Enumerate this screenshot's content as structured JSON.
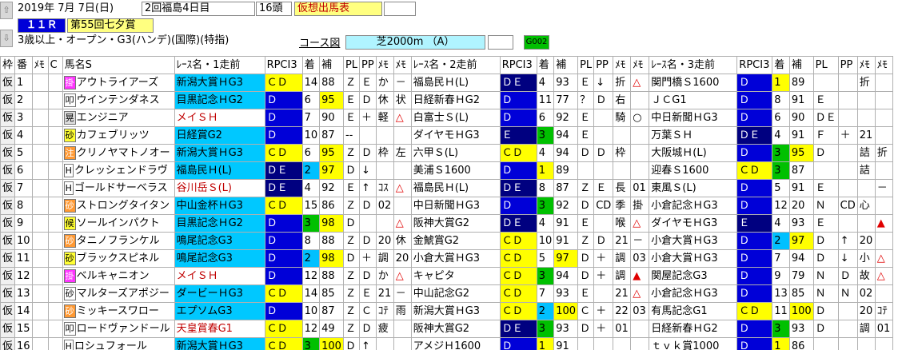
{
  "header": {
    "up_arrow": "⇧",
    "down_arrow": "⇩",
    "date": "2019年 7月 7日(日)",
    "meet": "2回福島4日目",
    "runners": "16頭",
    "mode_badge": "仮想出馬表",
    "race_no": "１１Ｒ",
    "race_name": "第55回七夕賞",
    "conditions": "3歳以上・オープン・G3(ハンデ)(国際)(特指)",
    "course_label": "コース図",
    "course": "芝2000m （A）",
    "code": "G002"
  },
  "columns": {
    "waku": "枠",
    "ban": "番",
    "memo": "ﾒﾓ",
    "c": "C",
    "name": "馬名S",
    "r1": "ﾚｰｽ名・1走前",
    "r2": "ﾚｰｽ名・2走前",
    "r3": "ﾚｰｽ名・3走前",
    "rpci": "RPCI3",
    "chaku": "着",
    "ho": "補",
    "pl": "PL",
    "pp": "PP",
    "m1": "ﾒﾓ",
    "m2": "ﾒﾓ"
  },
  "colors": {
    "race_blue": "#0000d8",
    "yellow": "#ffff80",
    "cyan": "#00c8ff",
    "green": "#00c000",
    "header_pink": "#ffcce0"
  },
  "horses": [
    {
      "waku": "仮",
      "ban": "1",
      "mark": "掛",
      "mk": "m",
      "name": "アウトライアーズ",
      "p1": [
        "新潟大賞ＨG3",
        "ＣＤ",
        "14",
        "88",
        "Ｚ",
        "Ｅ",
        "か",
        "－"
      ],
      "p2": [
        "福島民Ｈ(L)",
        "ＤＥ",
        "4",
        "93",
        "Ｅ",
        "↓",
        "折",
        "△"
      ],
      "p3": [
        "関門橋Ｓ1600",
        "Ｄ",
        "1",
        "89",
        "",
        "",
        "折",
        ""
      ]
    },
    {
      "waku": "仮",
      "ban": "2",
      "mark": "叩",
      "mk": "w",
      "name": "ウインテンダネス",
      "p1": [
        "目黒記念ＨG2",
        "Ｄ",
        "6",
        "95",
        "Ｅ",
        "Ｄ",
        "休",
        "状"
      ],
      "p2": [
        "日経新春ＨG2",
        "Ｄ",
        "11",
        "77",
        "？",
        "Ｄ",
        "右",
        ""
      ],
      "p3": [
        "ＪＣG1",
        "Ｄ",
        "8",
        "91",
        "Ｅ",
        "",
        "",
        ""
      ]
    },
    {
      "waku": "仮",
      "ban": "3",
      "mark": "晃",
      "mk": "h",
      "name": "エンジニア",
      "p1": [
        "メイＳＨ",
        "Ｄ",
        "7",
        "90",
        "Ｅ",
        "＋",
        "軽",
        "△"
      ],
      "p2": [
        "白富士Ｓ(L)",
        "Ｄ",
        "6",
        "92",
        "Ｅ",
        "",
        "騎",
        "○"
      ],
      "p3": [
        "中日新聞ＨG3",
        "Ｄ",
        "6",
        "90",
        "ＤＥ",
        "",
        "",
        ""
      ]
    },
    {
      "waku": "仮",
      "ban": "4",
      "mark": "砂",
      "mk": "s",
      "name": "カフェブリッツ",
      "p1": [
        "日経賞G2",
        "Ｄ",
        "10",
        "87",
        "--",
        "",
        "",
        ""
      ],
      "p2": [
        "ダイヤモＨG3",
        "Ｅ",
        "3",
        "94",
        "Ｅ",
        "",
        "",
        ""
      ],
      "p3": [
        "万葉ＳＨ",
        "ＤＥ",
        "4",
        "91",
        "Ｆ",
        "＋",
        "21",
        ""
      ]
    },
    {
      "waku": "仮",
      "ban": "5",
      "mark": "注",
      "mk": "sa",
      "name": "クリノヤマトノオー",
      "p1": [
        "新潟大賞ＨG3",
        "ＣＤ",
        "6",
        "95",
        "Ｚ",
        "Ｄ",
        "枠",
        "左"
      ],
      "p2": [
        "六甲Ｓ(L)",
        "ＣＤ",
        "4",
        "94",
        "Ｄ",
        "Ｄ",
        "枠",
        ""
      ],
      "p3": [
        "大阪城Ｈ(L)",
        "Ｄ",
        "3",
        "95",
        "Ｄ",
        "",
        "詰",
        "折"
      ]
    },
    {
      "waku": "仮",
      "ban": "6",
      "mark": "H",
      "mk": "w",
      "name": "クレッシェンドラヴ",
      "p1": [
        "福島民Ｈ(L)",
        "ＤＥ",
        "2",
        "97",
        "Ｄ",
        "↓",
        "",
        ""
      ],
      "p2": [
        "美浦Ｓ1600",
        "Ｄ",
        "1",
        "89",
        "",
        "",
        "",
        ""
      ],
      "p3": [
        "迎春Ｓ1600",
        "ＣＤ",
        "3",
        "87",
        "",
        "",
        "詰",
        ""
      ]
    },
    {
      "waku": "仮",
      "ban": "7",
      "mark": "H",
      "mk": "w",
      "name": "ゴールドサーベラス",
      "p1": [
        "谷川岳Ｓ(L)",
        "ＤＥ",
        "4",
        "92",
        "Ｅ",
        "↑",
        "ｺｽ",
        "△"
      ],
      "p2": [
        "福島民Ｈ(L)",
        "ＤＥ",
        "8",
        "87",
        "Ｚ",
        "Ｅ",
        "長",
        "01"
      ],
      "p3": [
        "東風Ｓ(L)",
        "Ｄ",
        "5",
        "91",
        "Ｅ",
        "",
        "",
        "－"
      ]
    },
    {
      "waku": "仮",
      "ban": "8",
      "mark": "砂",
      "mk": "sa",
      "name": "ストロングタイタン",
      "p1": [
        "中山金杯ＨG3",
        "ＣＤ",
        "15",
        "86",
        "Ｚ",
        "Ｄ",
        "02",
        ""
      ],
      "p2": [
        "中日新聞ＨG3",
        "Ｄ",
        "3",
        "92",
        "Ｄ",
        "CD",
        "季",
        "掛"
      ],
      "p3": [
        "小倉記念ＨG3",
        "Ｄ",
        "12",
        "20",
        "Ｎ",
        "CD",
        "心",
        ""
      ]
    },
    {
      "waku": "仮",
      "ban": "9",
      "mark": "候",
      "mk": "s",
      "name": "ソールインパクト",
      "p1": [
        "目黒記念ＨG2",
        "Ｄ",
        "3",
        "98",
        "Ｄ",
        "",
        "",
        "△"
      ],
      "p2": [
        "阪神大賞G2",
        "ＤＥ",
        "4",
        "91",
        "Ｅ",
        "",
        "喉",
        "△"
      ],
      "p3": [
        "ダイヤモＨG3",
        "Ｅ",
        "4",
        "93",
        "Ｅ",
        "",
        "",
        "▲"
      ]
    },
    {
      "waku": "仮",
      "ban": "10",
      "mark": "砂",
      "mk": "sa",
      "name": "タニノフランケル",
      "p1": [
        "鳴尾記念G3",
        "Ｄ",
        "8",
        "88",
        "Ｚ",
        "Ｄ",
        "20",
        "休"
      ],
      "p2": [
        "金鯱賞G2",
        "ＣＤ",
        "10",
        "91",
        "Ｚ",
        "Ｄ",
        "21",
        "－"
      ],
      "p3": [
        "小倉大賞ＨG3",
        "Ｄ",
        "2",
        "97",
        "Ｄ",
        "↑",
        "20",
        ""
      ]
    },
    {
      "waku": "仮",
      "ban": "11",
      "mark": "砂",
      "mk": "s",
      "name": "ブラックスピネル",
      "p1": [
        "鳴尾記念G3",
        "Ｄ",
        "2",
        "98",
        "Ｄ",
        "＋",
        "調",
        "20"
      ],
      "p2": [
        "小倉大賞ＨG3",
        "ＣＤ",
        "5",
        "97",
        "Ｄ",
        "＋",
        "調",
        "03"
      ],
      "p3": [
        "小倉大賞ＨG3",
        "Ｄ",
        "7",
        "94",
        "Ｄ",
        "↓",
        "小",
        "△"
      ]
    },
    {
      "waku": "仮",
      "ban": "12",
      "mark": "掛",
      "mk": "m",
      "name": "ベルキャニオン",
      "p1": [
        "メイＳＨ",
        "Ｄ",
        "12",
        "88",
        "Ｚ",
        "Ｄ",
        "か",
        "△"
      ],
      "p2": [
        "キャピタ",
        "ＣＤ",
        "3",
        "94",
        "Ｄ",
        "＋",
        "調",
        "▲"
      ],
      "p3": [
        "関屋記念G3",
        "Ｄ",
        "9",
        "79",
        "Ｎ",
        "Ｄ",
        "故",
        "△"
      ]
    },
    {
      "waku": "仮",
      "ban": "13",
      "mark": "砂",
      "mk": "w",
      "name": "マルターズアポジー",
      "p1": [
        "ダービーＨG3",
        "ＣＤ",
        "14",
        "85",
        "Ｚ",
        "Ｅ",
        "21",
        "－"
      ],
      "p2": [
        "中山記念G2",
        "ＣＤ",
        "7",
        "93",
        "Ｅ",
        "",
        "21",
        "△"
      ],
      "p3": [
        "小倉記念ＨG3",
        "Ｄ",
        "13",
        "85",
        "Ｎ",
        "Ｎ",
        "02",
        ""
      ]
    },
    {
      "waku": "仮",
      "ban": "14",
      "mark": "砂",
      "mk": "sa",
      "name": "ミッキースワロー",
      "p1": [
        "エプソムG3",
        "Ｄ",
        "10",
        "87",
        "Ｚ",
        "Ｃ",
        "ｺﾃ",
        "雨"
      ],
      "p2": [
        "新潟大賞ＨG3",
        "ＣＤ",
        "2",
        "100",
        "Ｃ",
        "＋",
        "22",
        "03"
      ],
      "p3": [
        "有馬記念G1",
        "ＣＤ",
        "11",
        "100",
        "Ｄ",
        "",
        "20",
        "ｺﾃ"
      ]
    },
    {
      "waku": "仮",
      "ban": "15",
      "mark": "叩",
      "mk": "w",
      "name": "ロードヴァンドール",
      "p1": [
        "天皇賞春G1",
        "ＣＤ",
        "12",
        "49",
        "Ｚ",
        "Ｄ",
        "疲",
        ""
      ],
      "p2": [
        "阪神大賞G2",
        "ＤＥ",
        "3",
        "93",
        "Ｄ",
        "＋",
        "01",
        ""
      ],
      "p3": [
        "日経新春ＨG2",
        "Ｄ",
        "3",
        "93",
        "Ｄ",
        "",
        "調",
        "01"
      ]
    },
    {
      "waku": "仮",
      "ban": "16",
      "mark": "H",
      "mk": "w",
      "name": "ロシュフォール",
      "p1": [
        "新潟大賞ＨG3",
        "ＣＤ",
        "3",
        "100",
        "Ｄ",
        "↑",
        "",
        ""
      ],
      "p2": [
        "アメジＨ1600",
        "Ｄ",
        "1",
        "91",
        "",
        "",
        "",
        ""
      ],
      "p3": [
        "ｔｖｋ賞1000",
        "Ｄ",
        "1",
        "86",
        "",
        "",
        "",
        ""
      ]
    }
  ]
}
